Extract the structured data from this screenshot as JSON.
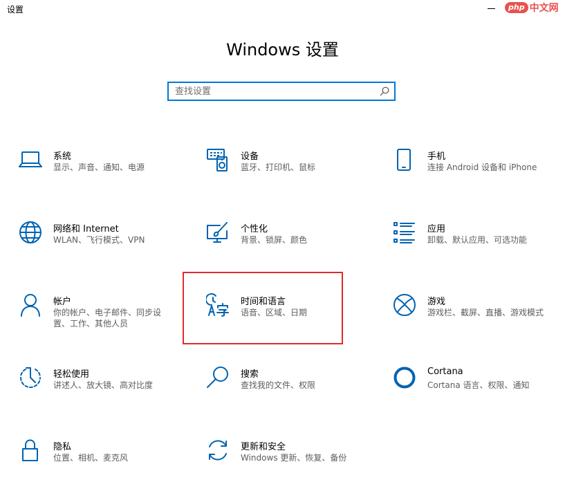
{
  "window": {
    "title": "设置"
  },
  "watermark": {
    "badge": "php",
    "text": "中文网"
  },
  "header": {
    "title": "Windows 设置"
  },
  "search": {
    "placeholder": "查找设置",
    "value": "",
    "icon": "search-icon"
  },
  "highlight_color": "#e02a2a",
  "accent_color": "#0063b1",
  "tiles": [
    {
      "name": "系统",
      "desc": "显示、声音、通知、电源",
      "icon": "laptop-icon"
    },
    {
      "name": "设备",
      "desc": "蓝牙、打印机、鼠标",
      "icon": "devices-icon"
    },
    {
      "name": "手机",
      "desc": "连接 Android 设备和 iPhone",
      "icon": "phone-icon"
    },
    {
      "name": "网络和 Internet",
      "desc": "WLAN、飞行模式、VPN",
      "icon": "globe-icon"
    },
    {
      "name": "个性化",
      "desc": "背景、锁屏、颜色",
      "icon": "personalization-icon"
    },
    {
      "name": "应用",
      "desc": "卸载、默认应用、可选功能",
      "icon": "apps-list-icon"
    },
    {
      "name": "帐户",
      "desc": "你的帐户、电子邮件、同步设置、工作、其他人员",
      "icon": "person-icon"
    },
    {
      "name": "时间和语言",
      "desc": "语音、区域、日期",
      "icon": "time-language-icon"
    },
    {
      "name": "游戏",
      "desc": "游戏栏、截屏、直播、游戏模式",
      "icon": "xbox-icon"
    },
    {
      "name": "轻松使用",
      "desc": "讲述人、放大镜、高对比度",
      "icon": "ease-of-access-icon"
    },
    {
      "name": "搜索",
      "desc": "查找我的文件、权限",
      "icon": "search-icon"
    },
    {
      "name": "Cortana",
      "desc": "Cortana 语言、权限、通知",
      "icon": "cortana-icon"
    },
    {
      "name": "隐私",
      "desc": "位置、相机、麦克风",
      "icon": "lock-icon"
    },
    {
      "name": "更新和安全",
      "desc": "Windows 更新、恢复、备份",
      "icon": "update-icon"
    }
  ]
}
